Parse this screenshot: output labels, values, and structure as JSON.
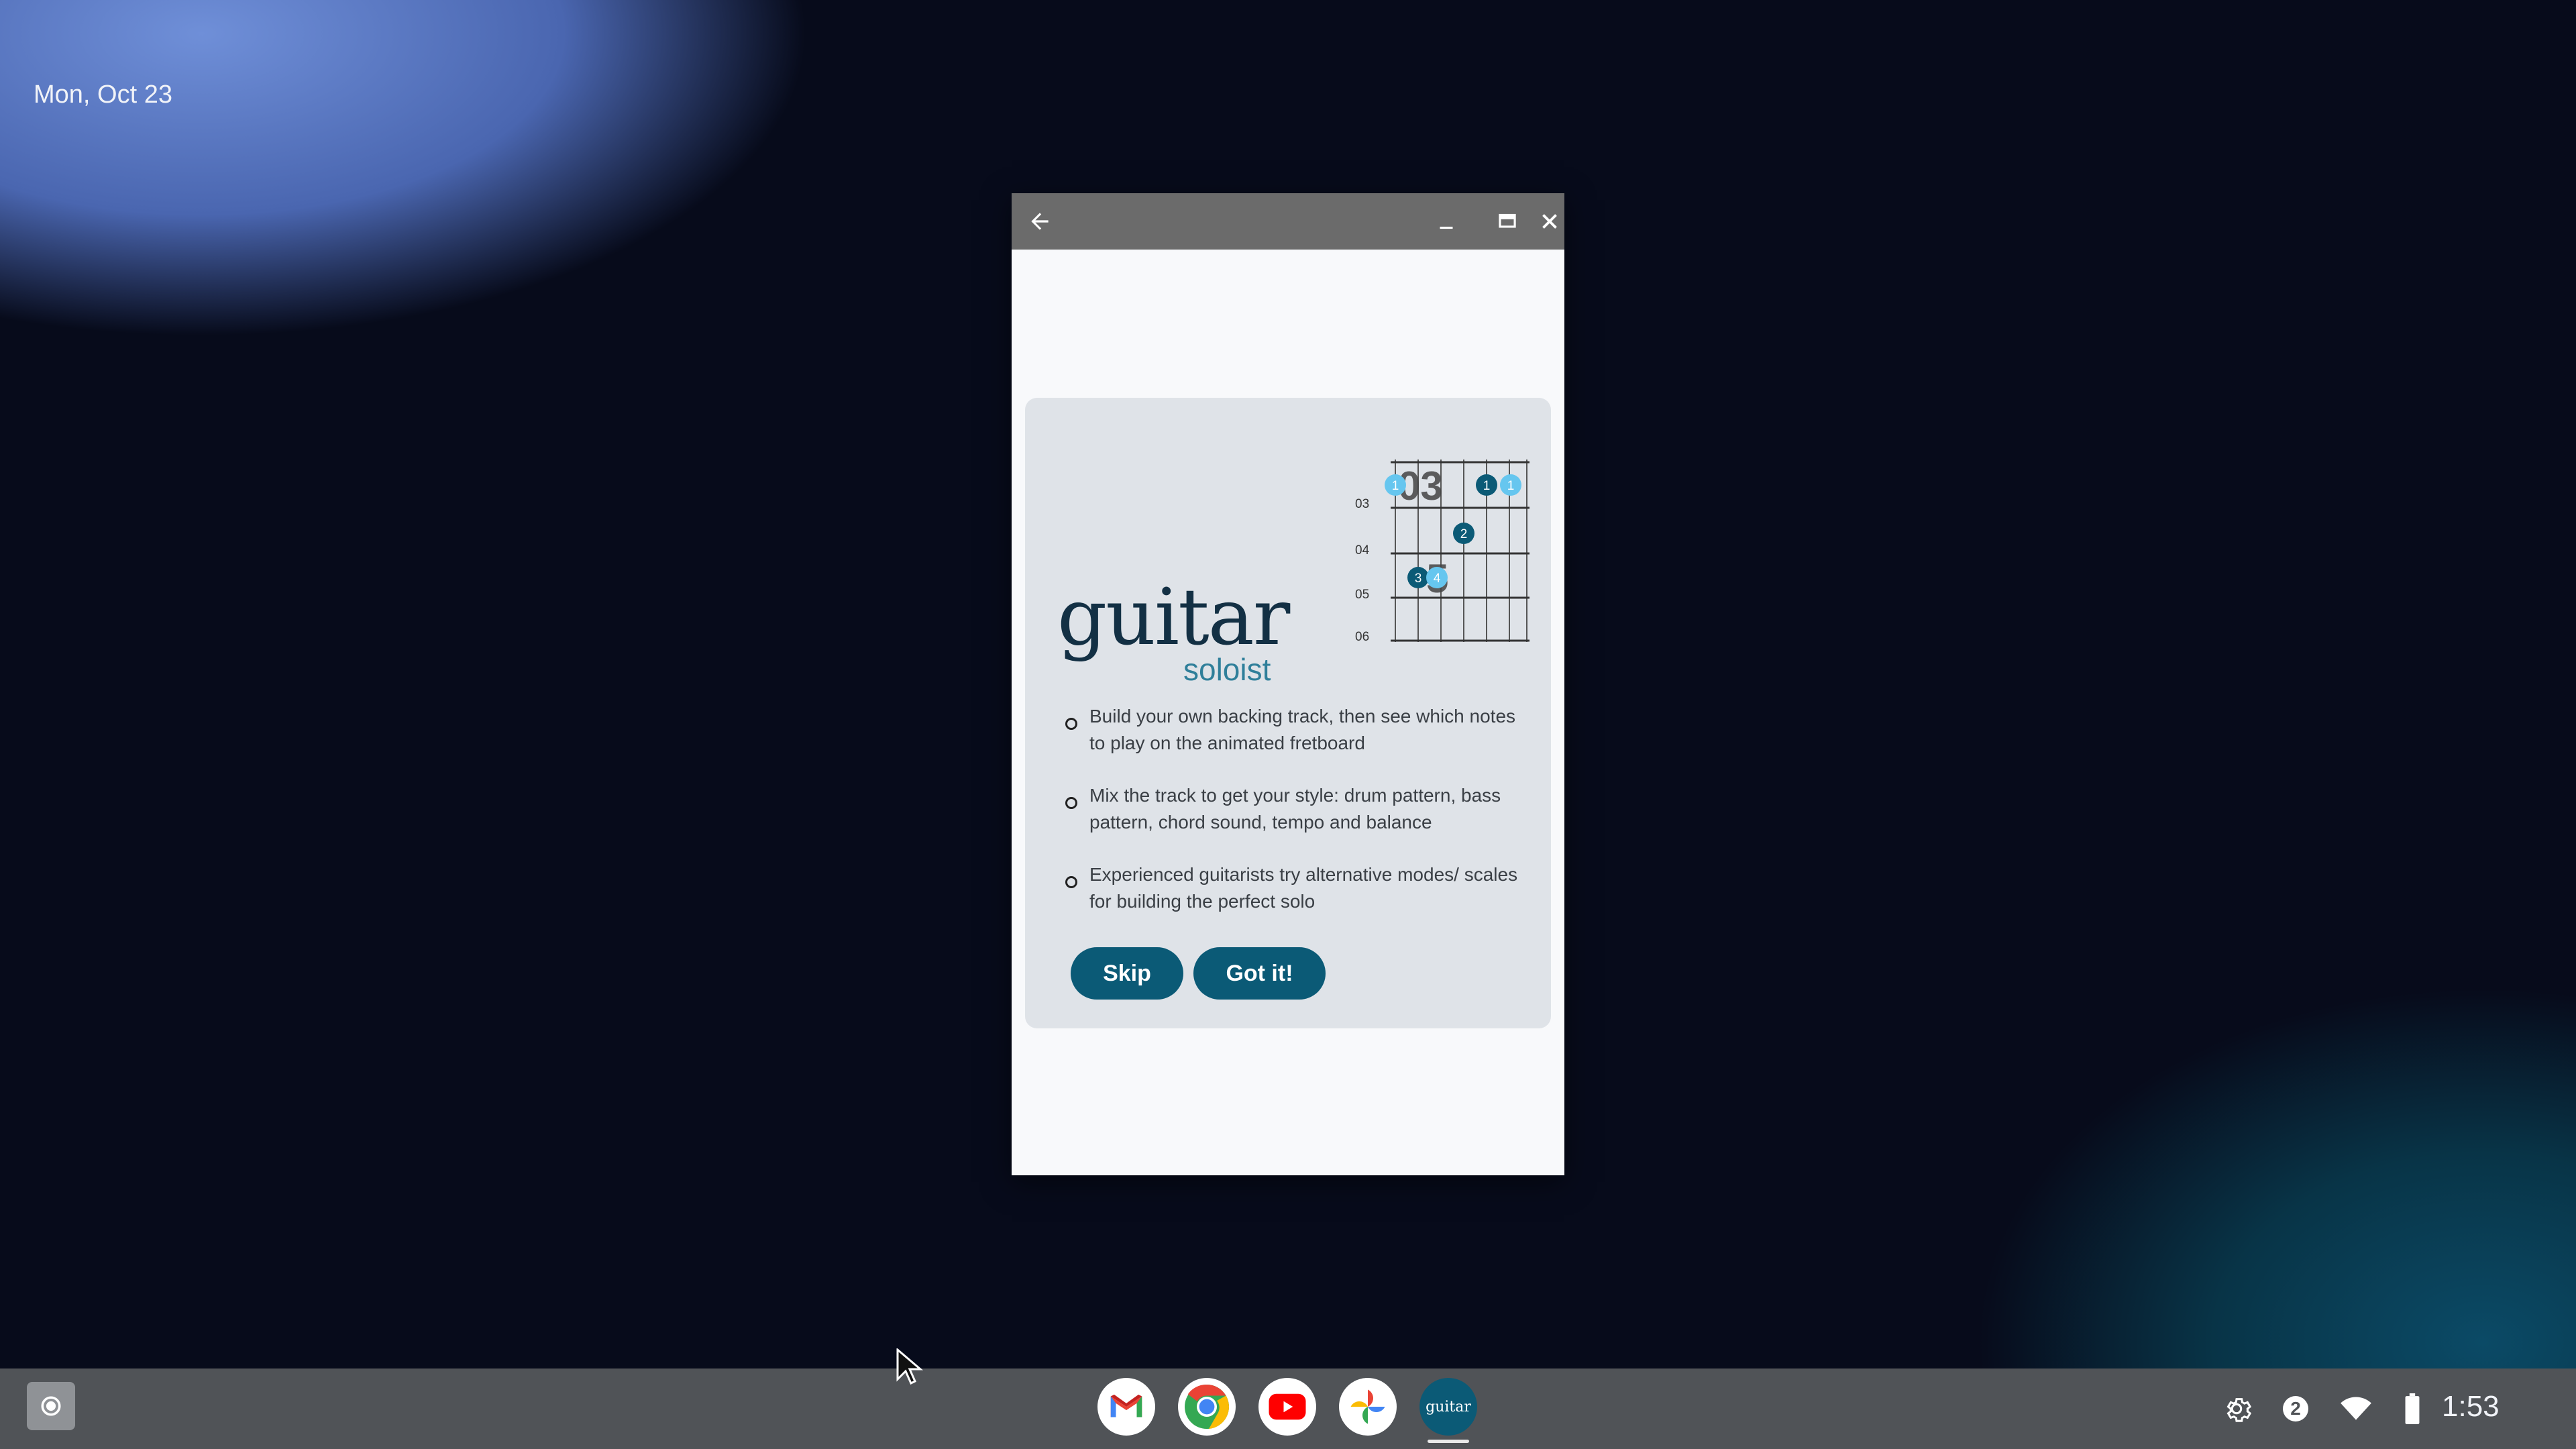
{
  "desktop": {
    "date": "Mon, Oct 23"
  },
  "window": {
    "back_icon": "back-arrow-icon",
    "minimize_icon": "minimize-icon",
    "maximize_icon": "maximize-icon",
    "close_icon": "close-icon"
  },
  "onboarding": {
    "logo_word": "guitar",
    "logo_sub": "soloist",
    "fretboard": {
      "fret_labels": [
        "03",
        "04",
        "05",
        "06"
      ],
      "overlay_numbers": [
        "03",
        "5"
      ],
      "dots": [
        {
          "label": "1",
          "color": "#66c6ef"
        },
        {
          "label": "1",
          "color": "#0b5a76"
        },
        {
          "label": "1",
          "color": "#66c6ef"
        },
        {
          "label": "2",
          "color": "#0b5a76"
        },
        {
          "label": "3",
          "color": "#0b5a76"
        },
        {
          "label": "4",
          "color": "#66c6ef"
        }
      ]
    },
    "features": [
      "Build your own backing track, then see which notes to play on the animated fretboard",
      "Mix the track to get your style: drum pattern, bass pattern, chord sound, tempo and balance",
      "Experienced guitarists try alternative modes/ scales for building the perfect solo"
    ],
    "skip_label": "Skip",
    "gotit_label": "Got it!"
  },
  "shelf": {
    "apps": [
      {
        "name": "Gmail",
        "icon": "gmail-icon"
      },
      {
        "name": "Chrome",
        "icon": "chrome-icon"
      },
      {
        "name": "YouTube",
        "icon": "youtube-icon"
      },
      {
        "name": "Photos",
        "icon": "photos-icon"
      },
      {
        "name": "Guitar Soloist",
        "icon": "guitar-soloist-icon",
        "label": "guitar"
      }
    ],
    "notification_count": "2",
    "time": "1:53"
  },
  "colors": {
    "accent": "#0b5a76",
    "light_accent": "#66c6ef",
    "card_bg": "#dfe3e8",
    "titlebar": "#6b6b6b"
  }
}
